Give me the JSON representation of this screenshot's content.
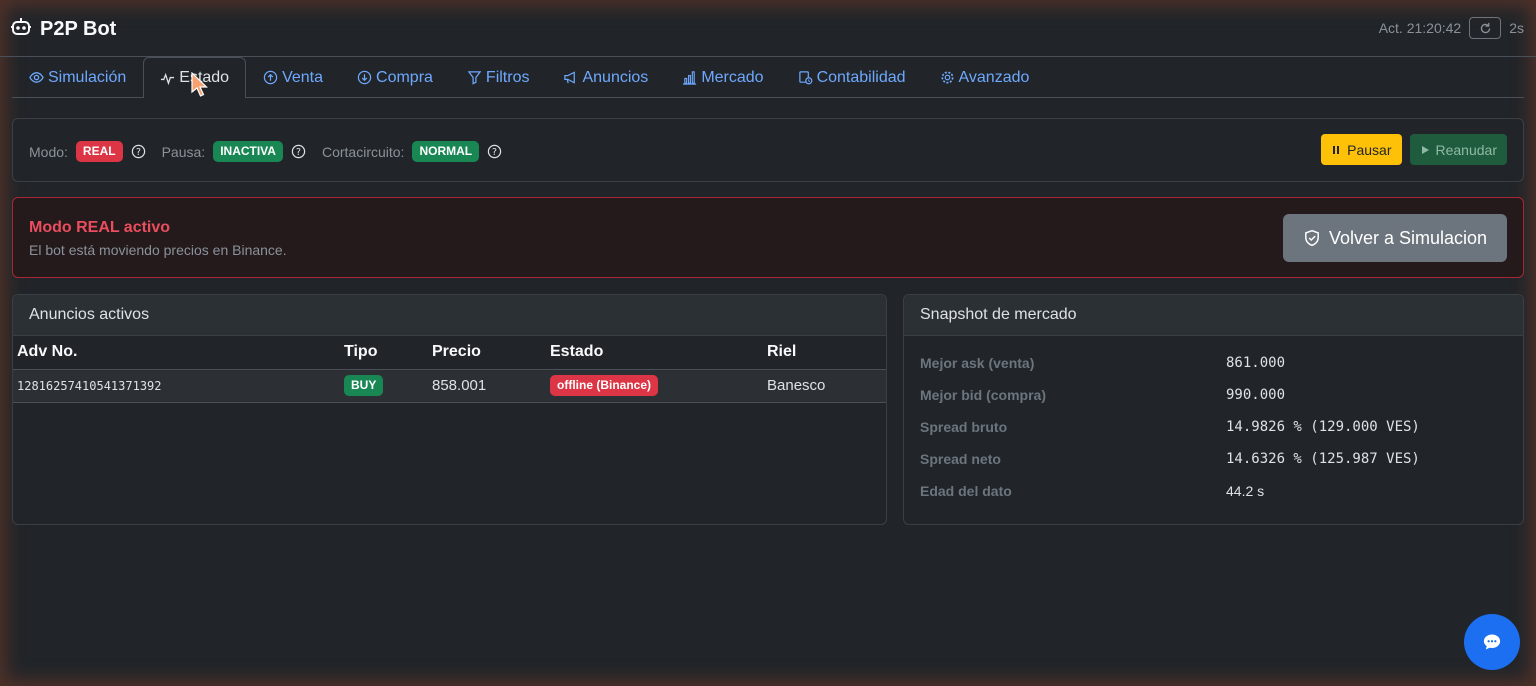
{
  "header": {
    "title": "P2P Bot",
    "last_update": "Act. 21:20:42",
    "interval": "2s"
  },
  "tabs": [
    {
      "label": "Simulación",
      "icon": "eye-icon"
    },
    {
      "label": "Estado",
      "icon": "activity-icon",
      "active": true
    },
    {
      "label": "Venta",
      "icon": "arrow-up-circle-icon"
    },
    {
      "label": "Compra",
      "icon": "arrow-down-circle-icon"
    },
    {
      "label": "Filtros",
      "icon": "filter-icon"
    },
    {
      "label": "Anuncios",
      "icon": "megaphone-icon"
    },
    {
      "label": "Mercado",
      "icon": "bar-chart-icon"
    },
    {
      "label": "Contabilidad",
      "icon": "calculator-icon"
    },
    {
      "label": "Avanzado",
      "icon": "gear-icon"
    }
  ],
  "status": {
    "mode_label": "Modo:",
    "mode_value": "REAL",
    "pause_label": "Pausa:",
    "pause_value": "INACTIVA",
    "breaker_label": "Cortacircuito:",
    "breaker_value": "NORMAL",
    "pause_button": "Pausar",
    "resume_button": "Reanudar"
  },
  "alert": {
    "title": "Modo REAL activo",
    "text": "El bot está moviendo precios en Binance.",
    "button": "Volver a Simulacion"
  },
  "ads": {
    "title": "Anuncios activos",
    "columns": [
      "Adv No.",
      "Tipo",
      "Precio",
      "Estado",
      "Riel"
    ],
    "rows": [
      {
        "adv_no": "12816257410541371392",
        "tipo": "BUY",
        "precio": "858.001",
        "estado": "offline (Binance)",
        "riel": "Banesco"
      }
    ]
  },
  "market": {
    "title": "Snapshot de mercado",
    "rows": [
      {
        "key": "Mejor ask (venta)",
        "value": "861.000"
      },
      {
        "key": "Mejor bid (compra)",
        "value": "990.000"
      },
      {
        "key": "Spread bruto",
        "value": "14.9826 % (129.000 VES)"
      },
      {
        "key": "Spread neto",
        "value": "14.6326 % (125.987 VES)"
      },
      {
        "key": "Edad del dato",
        "value": "44.2 s"
      }
    ]
  },
  "colors": {
    "accent": "#6ea8fe",
    "danger": "#dc3545",
    "success": "#198754",
    "warning": "#ffc107",
    "chat_button": "#1c6ff0"
  }
}
